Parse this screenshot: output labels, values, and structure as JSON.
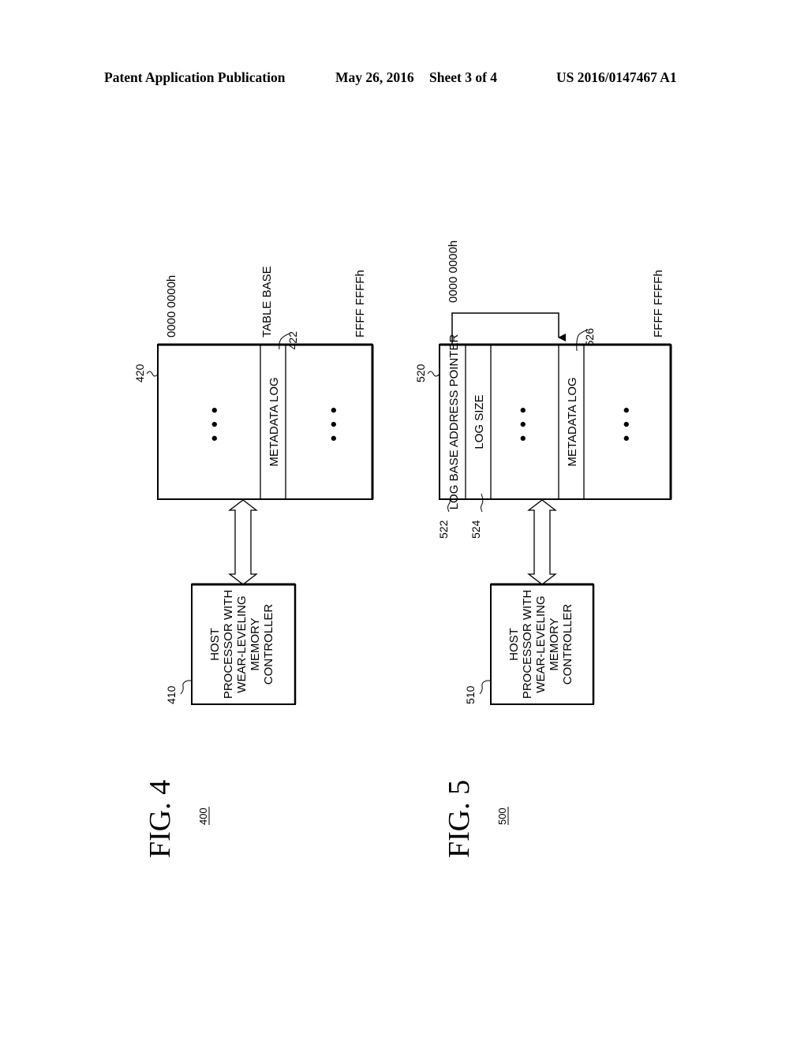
{
  "header": {
    "publication": "Patent Application Publication",
    "date": "May 26, 2016",
    "sheet": "Sheet 3 of 4",
    "number": "US 2016/0147467 A1"
  },
  "fig4": {
    "title": "FIG. 4",
    "ref": "400",
    "memory": {
      "ref": "420",
      "start_addr": "0000 0000h",
      "end_addr": "FFFF FFFFh",
      "table_base_label": "TABLE BASE",
      "metadata_ref": "422",
      "ellipsis_1": "• • •",
      "metadata_label": "METADATA LOG",
      "ellipsis_2": "• • •"
    },
    "host": {
      "ref": "410",
      "lines": [
        "HOST",
        "PROCESSOR WITH",
        "WEAR-LEVELING",
        "MEMORY",
        "CONTROLLER"
      ]
    }
  },
  "fig5": {
    "title": "FIG. 5",
    "ref": "500",
    "memory": {
      "ref": "520",
      "start_addr": "0000 0000h",
      "end_addr": "FFFF FFFFh",
      "pointer_label": "LOG BASE ADDRESS POINTER",
      "pointer_ref": "522",
      "size_label": "LOG SIZE",
      "size_ref": "524",
      "ellipsis_1": "• • •",
      "metadata_label": "METADATA LOG",
      "metadata_ref": "526",
      "ellipsis_2": "• • •"
    },
    "host": {
      "ref": "510",
      "lines": [
        "HOST",
        "PROCESSOR WITH",
        "WEAR-LEVELING",
        "MEMORY",
        "CONTROLLER"
      ]
    }
  }
}
